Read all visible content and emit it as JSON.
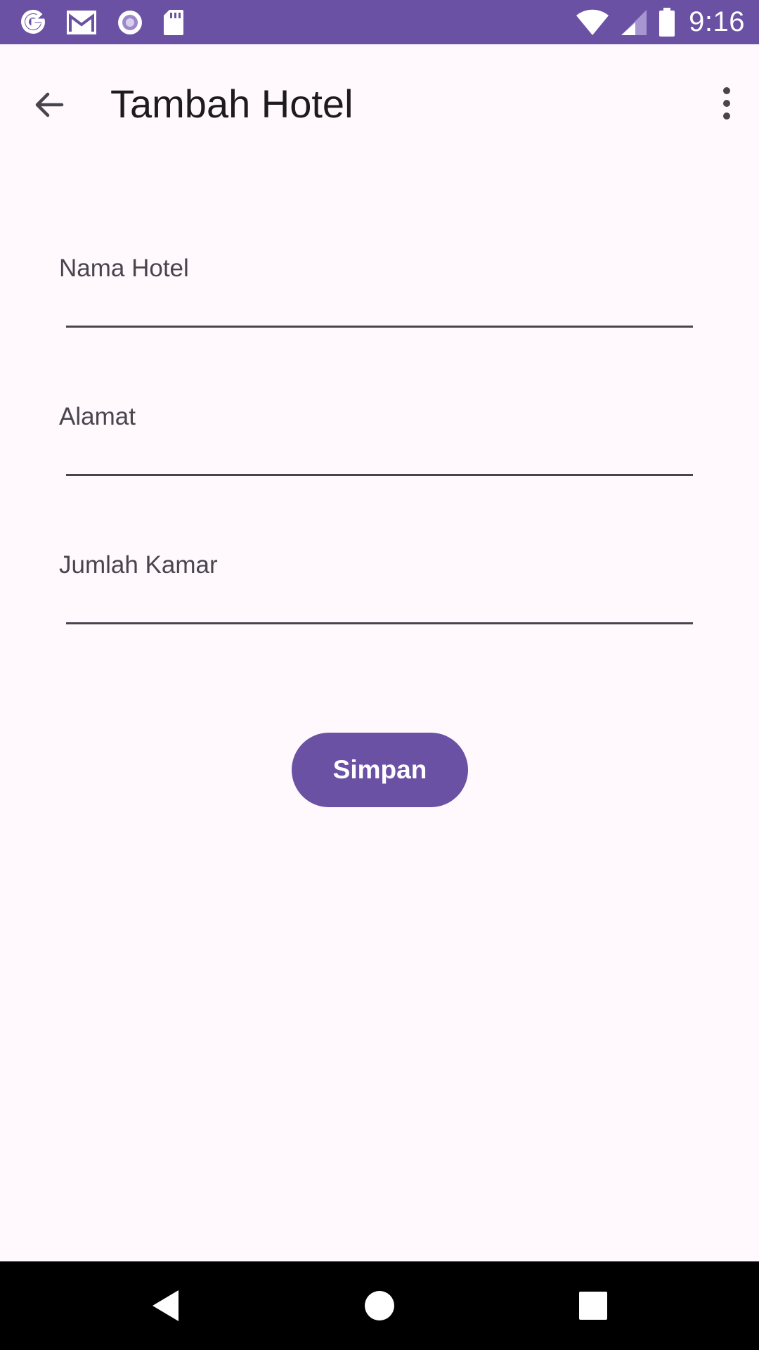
{
  "status_bar": {
    "time": "9:16",
    "left_icons": [
      "google-icon",
      "gmail-icon",
      "record-icon",
      "sd-card-icon"
    ],
    "right_icons": [
      "wifi-icon",
      "signal-icon",
      "battery-icon"
    ]
  },
  "app_bar": {
    "title": "Tambah Hotel",
    "back_icon": "arrow-back-icon",
    "menu_icon": "more-vert-icon"
  },
  "form": {
    "fields": [
      {
        "label": "Nama Hotel",
        "value": ""
      },
      {
        "label": "Alamat",
        "value": ""
      },
      {
        "label": "Jumlah Kamar",
        "value": ""
      }
    ],
    "submit_label": "Simpan"
  },
  "nav_bar": {
    "icons": [
      "nav-back-icon",
      "nav-home-icon",
      "nav-recents-icon"
    ]
  },
  "colors": {
    "primary": "#6A51A3",
    "background": "#FFF9FD",
    "text": "#1D1B20",
    "label": "#49454F"
  }
}
